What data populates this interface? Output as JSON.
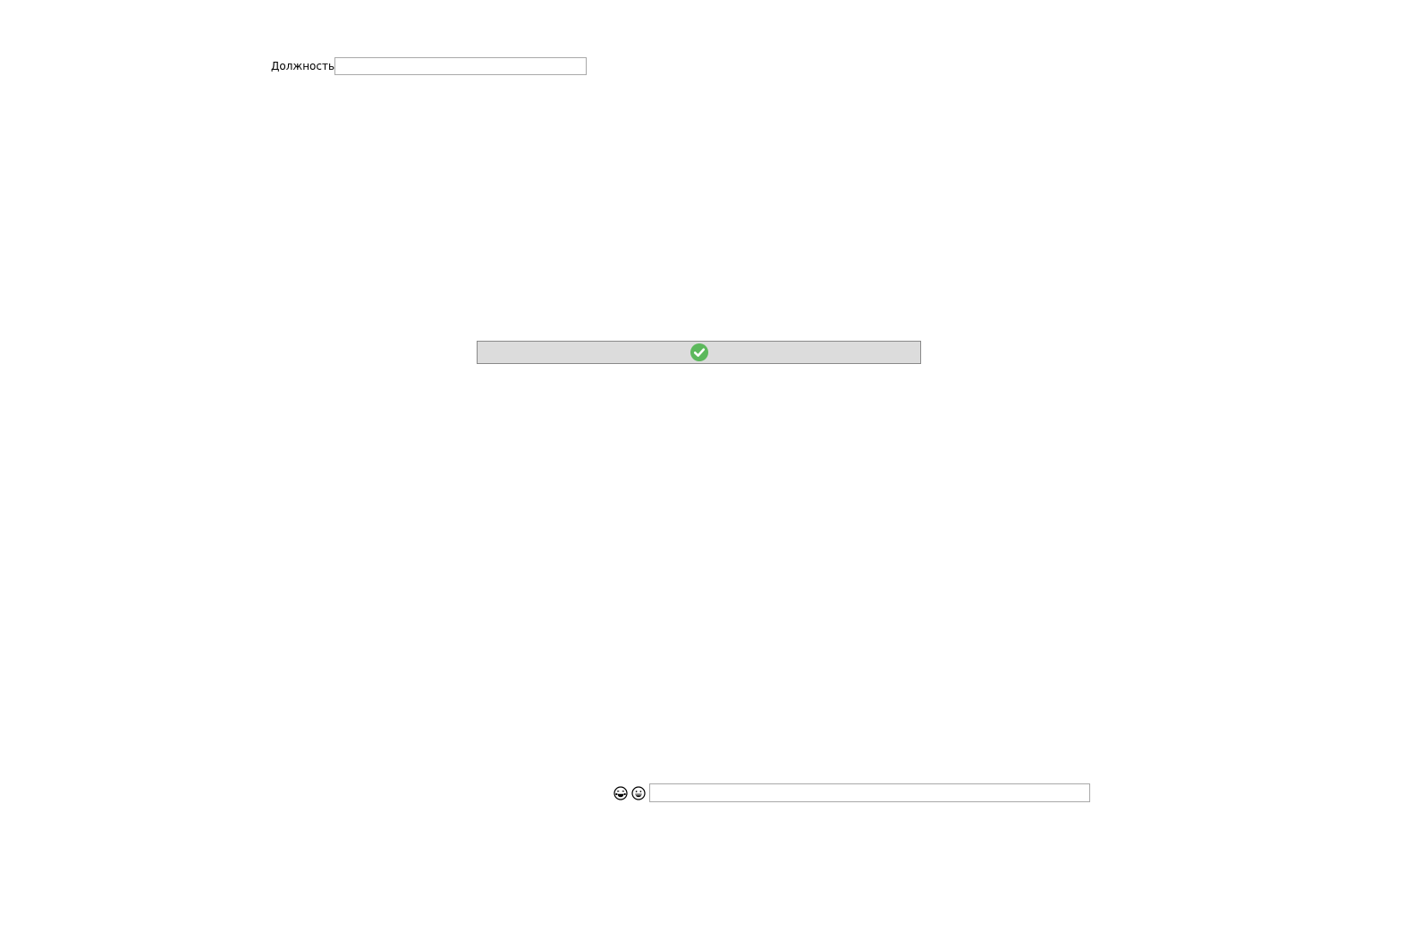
{
  "form": {
    "position_label": "Должность",
    "position_value": "",
    "confirm_icon": "check-circle-icon",
    "confirm_color": "#5cb85c",
    "comment_value": ""
  },
  "emoji_bar": {
    "icons": [
      "laughing-tears-emoji-icon",
      "grinning-emoji-icon"
    ]
  }
}
